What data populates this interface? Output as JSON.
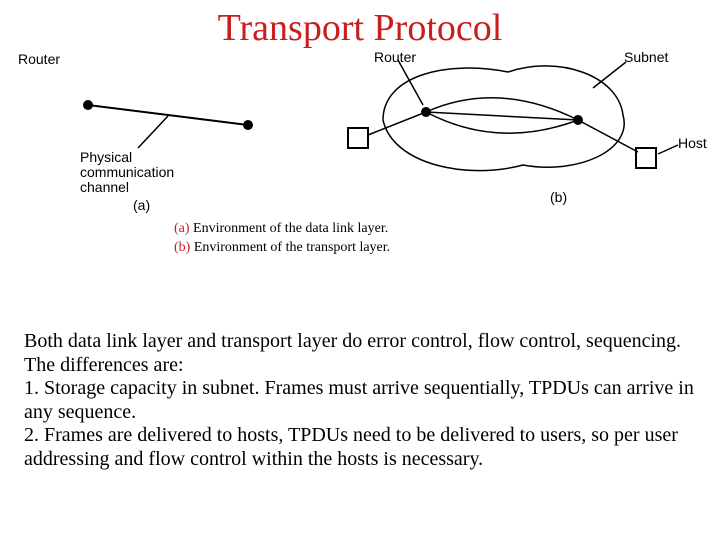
{
  "title": "Transport Protocol",
  "labels": {
    "router_left": "Router",
    "router_right": "Router",
    "subnet": "Subnet",
    "phys_line1": "Physical",
    "phys_line2": "communication",
    "phys_line3": "channel",
    "host": "Host",
    "fig_a": "(a)",
    "fig_b": "(b)"
  },
  "caption": {
    "a_marker": "(a)",
    "a_text": " Environment of the data link layer.",
    "b_marker": "(b)",
    "b_text": " Environment of the transport layer."
  },
  "body": {
    "p1": "Both data link layer and transport layer do error control, flow control, sequencing. The differences are:",
    "p2": "1. Storage capacity in subnet. Frames must arrive sequentially, TPDUs can arrive in any sequence.",
    "p3": "2. Frames are delivered to hosts, TPDUs need to be delivered to users, so per user addressing and  flow control within the hosts is necessary."
  }
}
